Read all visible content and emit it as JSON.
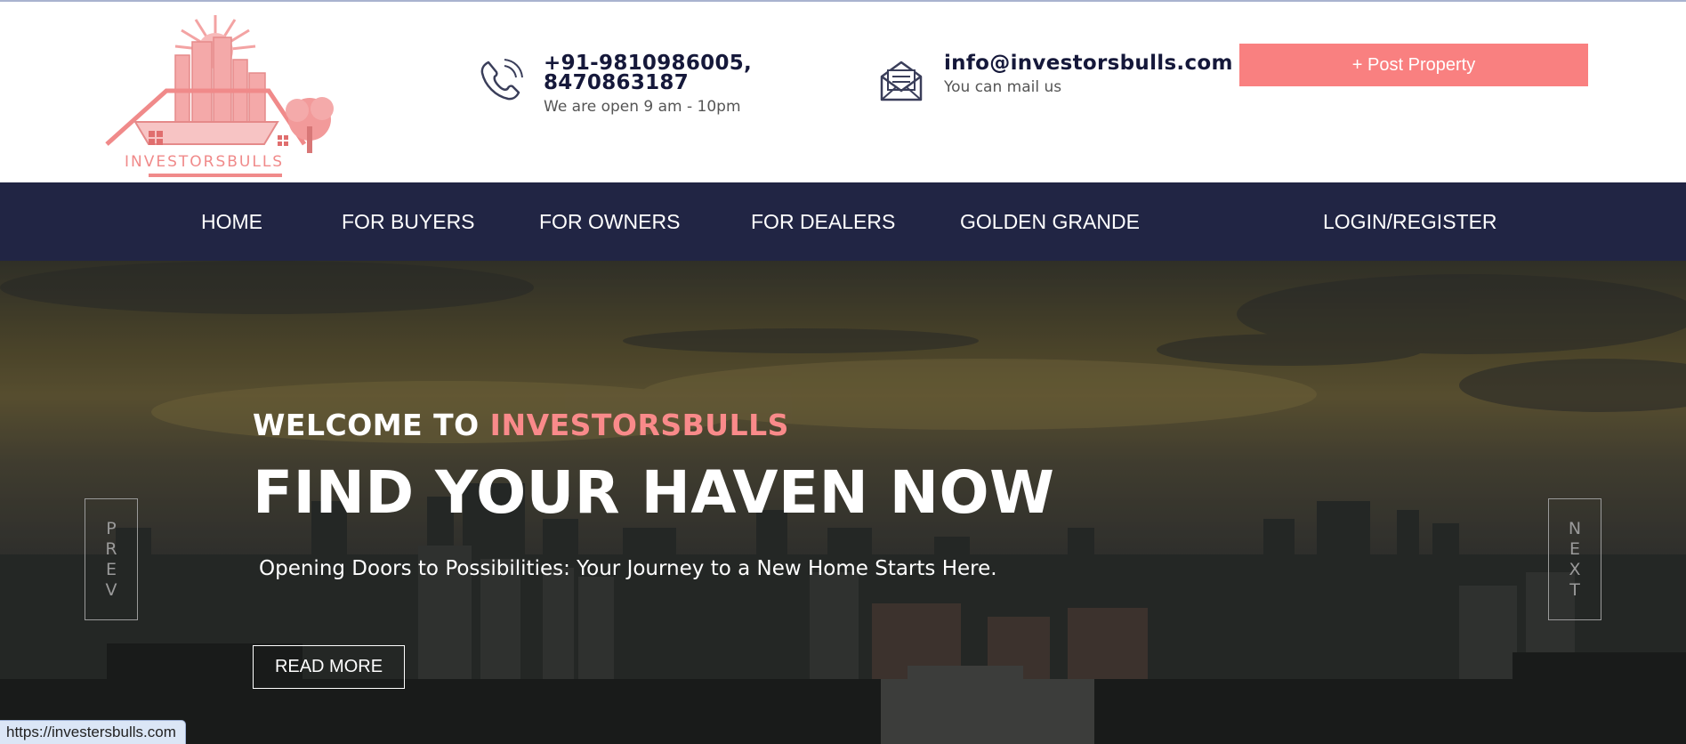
{
  "logo": {
    "text": "INVESTORSBULLS"
  },
  "header": {
    "phone": {
      "icon": "phone-icon",
      "number": "+91-9810986005, 8470863187",
      "hours": "We are open 9 am - 10pm"
    },
    "email": {
      "icon": "envelope-icon",
      "address": "info@investorsbulls.com",
      "note": "You can mail us"
    },
    "post_property_label": "+ Post Property"
  },
  "nav": {
    "items": [
      {
        "label": "HOME"
      },
      {
        "label": "FOR BUYERS"
      },
      {
        "label": "FOR OWNERS"
      },
      {
        "label": "FOR DEALERS"
      },
      {
        "label": "GOLDEN GRANDE"
      },
      {
        "label": "LOGIN/REGISTER"
      }
    ]
  },
  "hero": {
    "welcome_prefix": "WELCOME TO ",
    "welcome_brand": "INVESTORSBULLS",
    "headline": "FIND YOUR HAVEN NOW",
    "subline": "Opening Doors to Possibilities: Your Journey to a New Home Starts Here.",
    "read_more_label": "READ MORE",
    "prev_letters": [
      "P",
      "R",
      "E",
      "V"
    ],
    "next_letters": [
      "N",
      "E",
      "X",
      "T"
    ]
  },
  "status_bar": {
    "url": "https://investersbulls.com"
  },
  "colors": {
    "accent": "#f98080",
    "nav_bg": "#212544",
    "text_dark": "#15183a"
  }
}
